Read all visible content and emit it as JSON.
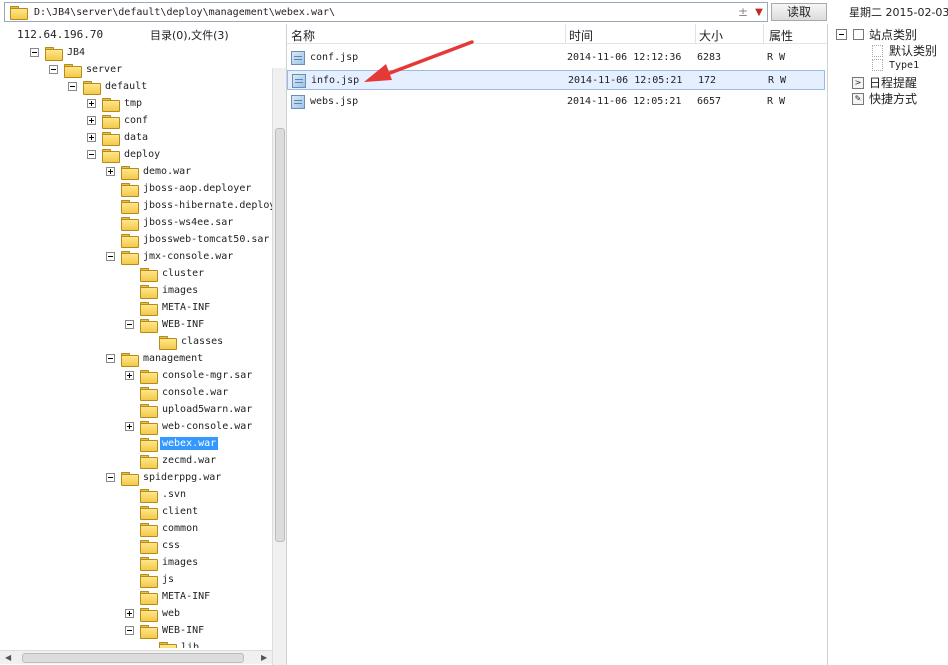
{
  "path_bar": {
    "path": "D:\\JB4\\server\\default\\deploy\\management\\webex.war\\",
    "read_button": "读取",
    "date": "星期二 2015-02-03"
  },
  "left_panel": {
    "ip": "112.64.196.70",
    "dir_count": "目录(0),文件(3)",
    "tree": [
      {
        "label": "JB4",
        "depth": 0,
        "expander": "minus"
      },
      {
        "label": "server",
        "depth": 1,
        "expander": "minus"
      },
      {
        "label": "default",
        "depth": 2,
        "expander": "minus"
      },
      {
        "label": "tmp",
        "depth": 3,
        "expander": "plus"
      },
      {
        "label": "conf",
        "depth": 3,
        "expander": "plus"
      },
      {
        "label": "data",
        "depth": 3,
        "expander": "plus"
      },
      {
        "label": "deploy",
        "depth": 3,
        "expander": "minus"
      },
      {
        "label": "demo.war",
        "depth": 4,
        "expander": "plus"
      },
      {
        "label": "jboss-aop.deployer",
        "depth": 4,
        "expander": "none"
      },
      {
        "label": "jboss-hibernate.deployer",
        "depth": 4,
        "expander": "none"
      },
      {
        "label": "jboss-ws4ee.sar",
        "depth": 4,
        "expander": "none"
      },
      {
        "label": "jbossweb-tomcat50.sar",
        "depth": 4,
        "expander": "none"
      },
      {
        "label": "jmx-console.war",
        "depth": 4,
        "expander": "minus"
      },
      {
        "label": "cluster",
        "depth": 5,
        "expander": "none"
      },
      {
        "label": "images",
        "depth": 5,
        "expander": "none"
      },
      {
        "label": "META-INF",
        "depth": 5,
        "expander": "none"
      },
      {
        "label": "WEB-INF",
        "depth": 5,
        "expander": "minus"
      },
      {
        "label": "classes",
        "depth": 6,
        "expander": "none"
      },
      {
        "label": "management",
        "depth": 4,
        "expander": "minus"
      },
      {
        "label": "console-mgr.sar",
        "depth": 5,
        "expander": "plus"
      },
      {
        "label": "console.war",
        "depth": 5,
        "expander": "none"
      },
      {
        "label": "upload5warn.war",
        "depth": 5,
        "expander": "none"
      },
      {
        "label": "web-console.war",
        "depth": 5,
        "expander": "plus"
      },
      {
        "label": "webex.war",
        "depth": 5,
        "expander": "none",
        "selected": true
      },
      {
        "label": "zecmd.war",
        "depth": 5,
        "expander": "none"
      },
      {
        "label": "spiderppg.war",
        "depth": 4,
        "expander": "minus"
      },
      {
        "label": ".svn",
        "depth": 5,
        "expander": "none"
      },
      {
        "label": "client",
        "depth": 5,
        "expander": "none"
      },
      {
        "label": "common",
        "depth": 5,
        "expander": "none"
      },
      {
        "label": "css",
        "depth": 5,
        "expander": "none"
      },
      {
        "label": "images",
        "depth": 5,
        "expander": "none"
      },
      {
        "label": "js",
        "depth": 5,
        "expander": "none"
      },
      {
        "label": "META-INF",
        "depth": 5,
        "expander": "none"
      },
      {
        "label": "web",
        "depth": 5,
        "expander": "plus"
      },
      {
        "label": "WEB-INF",
        "depth": 5,
        "expander": "minus"
      },
      {
        "label": "lib",
        "depth": 6,
        "expander": "none"
      }
    ]
  },
  "file_list": {
    "columns": {
      "name": "名称",
      "time": "时间",
      "size": "大小",
      "attr": "属性"
    },
    "rows": [
      {
        "name": "conf.jsp",
        "time": "2014-11-06 12:12:36",
        "size": "6283",
        "attr": "R W",
        "selected": false
      },
      {
        "name": "info.jsp",
        "time": "2014-11-06 12:05:21",
        "size": "172",
        "attr": "R W",
        "selected": true
      },
      {
        "name": "webs.jsp",
        "time": "2014-11-06 12:05:21",
        "size": "6657",
        "attr": "R W",
        "selected": false
      }
    ]
  },
  "right_panel": {
    "site_category": "站点类别",
    "default_category": "默认类别",
    "type1": "Type1",
    "schedule": "日程提醒",
    "shortcut": "快捷方式"
  },
  "colors": {
    "selection": "#3399ff",
    "arrow": "#e53935",
    "folder": "#f3c94a"
  },
  "icons": [
    "folder-icon",
    "file-icon",
    "expander-icon",
    "dropdown-icon",
    "add-icon"
  ]
}
